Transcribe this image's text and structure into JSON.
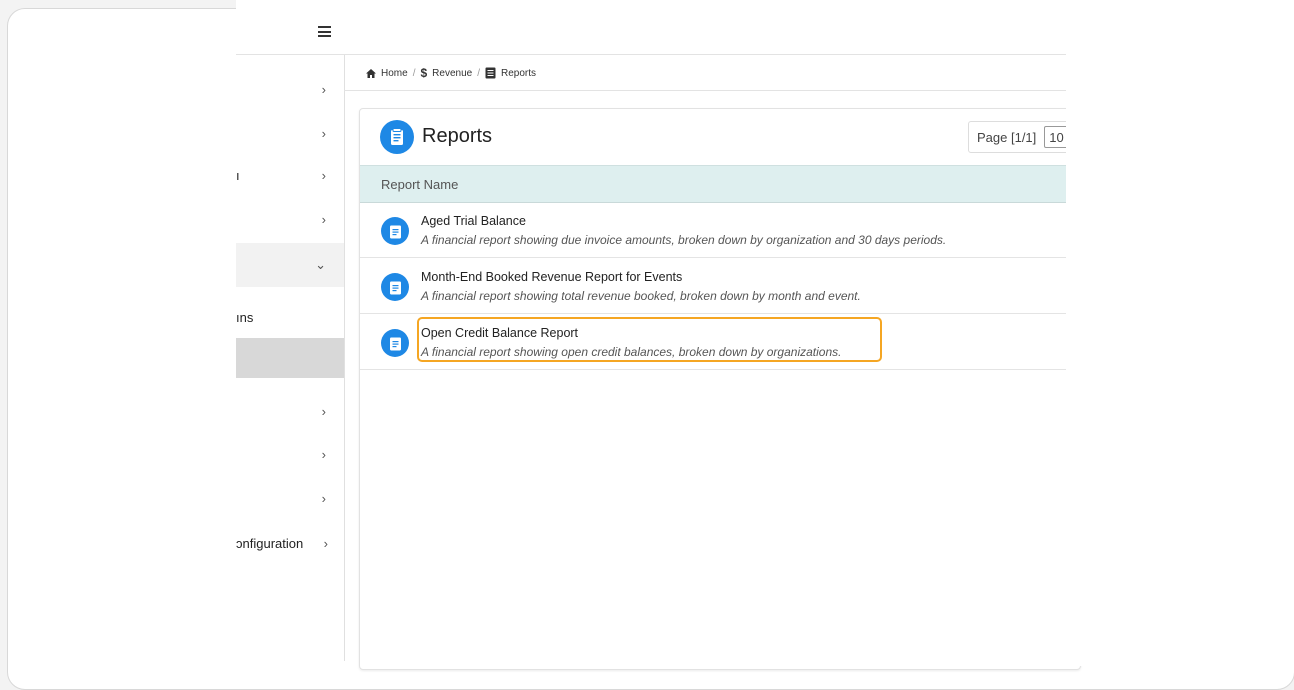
{
  "sidebar": {
    "items": [
      {
        "label": "",
        "chevron": "›"
      },
      {
        "label": "",
        "chevron": "›"
      },
      {
        "label": "ı",
        "chevron": "›"
      },
      {
        "label": "",
        "chevron": "›"
      },
      {
        "label": "",
        "chevron": "⌄"
      },
      {
        "label": "ıns",
        "chevron": ""
      },
      {
        "label": "",
        "chevron": ""
      },
      {
        "label": "",
        "chevron": "›"
      },
      {
        "label": "",
        "chevron": "›"
      },
      {
        "label": "",
        "chevron": "›"
      },
      {
        "label": "ɔnfiguration",
        "chevron": "›"
      }
    ]
  },
  "breadcrumb": {
    "home": "Home",
    "sep": "/",
    "revenue_symbol": "$",
    "revenue": "Revenue",
    "reports": "Reports"
  },
  "panel": {
    "title": "Reports",
    "pager_text": "Page [1/1]",
    "page_size": "10",
    "column_header": "Report Name"
  },
  "reports": [
    {
      "name": "Aged Trial Balance",
      "description": "A financial report showing due invoice amounts, broken down by organization and 30 days periods."
    },
    {
      "name": "Month-End Booked Revenue Report for Events",
      "description": "A financial report showing total revenue booked, broken down by month and event."
    },
    {
      "name": "Open Credit Balance Report",
      "description": "A financial report showing open credit balances, broken down by organizations."
    }
  ],
  "colors": {
    "accent": "#1e88e5",
    "highlight": "#f5a623",
    "header_bg": "#deefef"
  }
}
